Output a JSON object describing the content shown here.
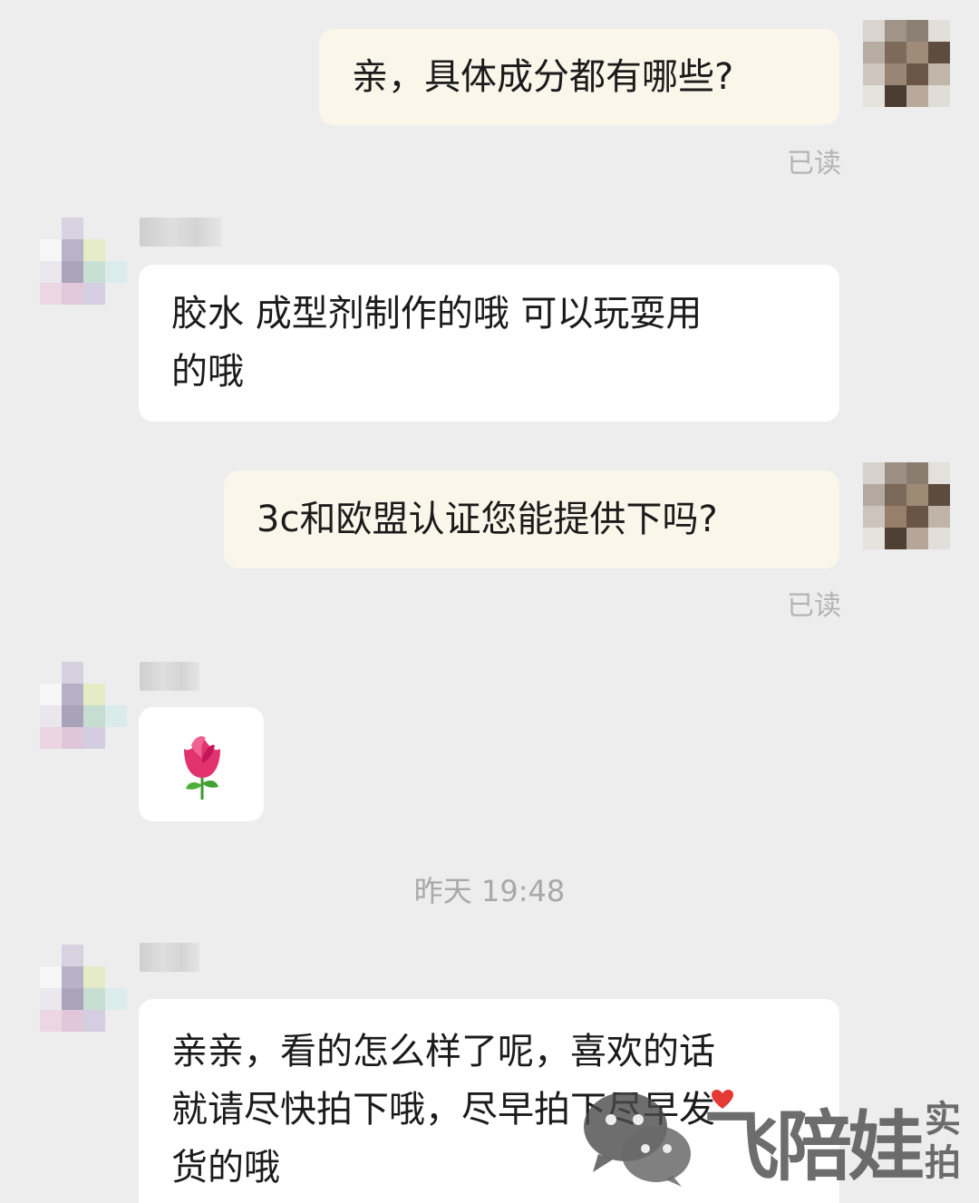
{
  "messages": [
    {
      "direction": "out",
      "text": "亲，具体成分都有哪些?",
      "status": "已读"
    },
    {
      "direction": "in",
      "text_lines": [
        "胶水 成型剂制作的哦 可以玩耍用",
        "的哦"
      ]
    },
    {
      "direction": "out",
      "text": "3c和欧盟认证您能提供下吗?",
      "status": "已读"
    },
    {
      "direction": "in",
      "emoji": "🌹"
    },
    {
      "direction": "in",
      "text_lines": [
        "亲亲，看的怎么样了呢，喜欢的话",
        "就请尽快拍下哦，尽早拍下尽早发",
        "货的哦"
      ]
    }
  ],
  "timestamp": "昨天 19:48",
  "watermark": {
    "brand": "飞陪娃",
    "side_text": [
      "实",
      "拍"
    ]
  },
  "colors": {
    "background": "#ededed",
    "outgoing_bubble": "#fbf6ea",
    "incoming_bubble": "#ffffff",
    "read_status": "#b4b4b4",
    "heart": "#e53935"
  }
}
